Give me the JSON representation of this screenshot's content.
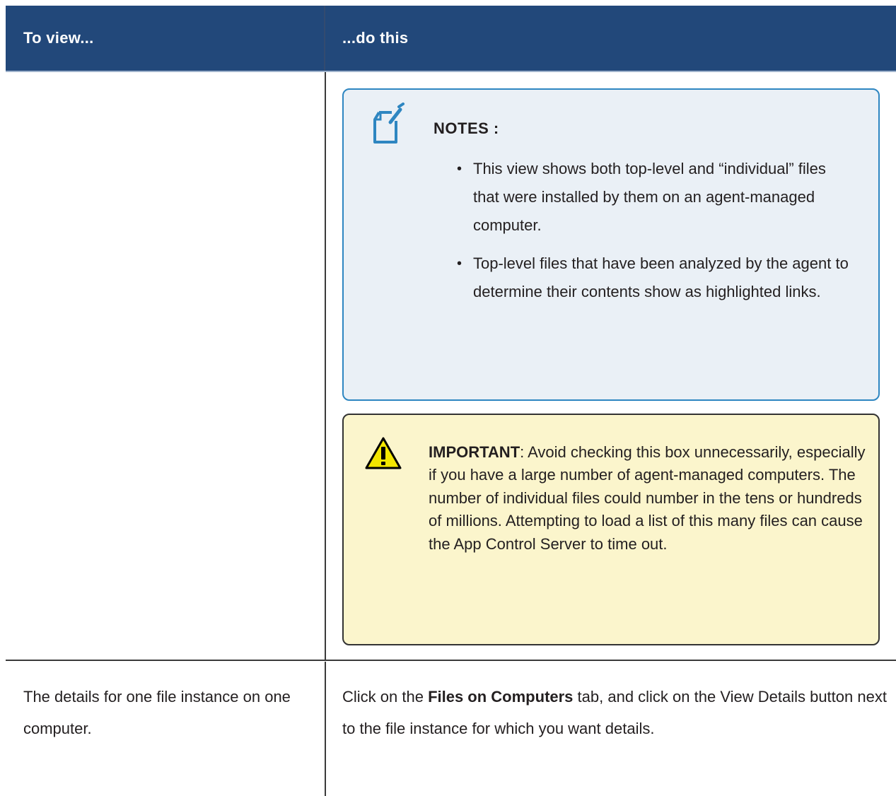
{
  "table": {
    "headers": {
      "left": "To view...",
      "right": "...do this"
    },
    "notes": {
      "title": "NOTES :",
      "items": [
        "This view shows both top-level and “individual” files that were installed by them on an agent-managed computer.",
        "Top-level files that have been analyzed by the agent to determine their contents show as highlighted links."
      ]
    },
    "important": {
      "label": "IMPORTANT",
      "text": ": Avoid checking this box unnecessarily, especially if you have a large number of agent-managed computers. The number of individual files could number in the tens or hundreds of millions. Attempting to load a list of this many files can cause the App Control Server to time out."
    },
    "row2": {
      "left": "The details for one file instance on one computer.",
      "right_before": "Click on the ",
      "right_bold": "Files on Computers",
      "right_after": " tab, and click on the View Details button next to the file instance for which you want details."
    }
  },
  "icons": {
    "notes": "note-pencil-icon",
    "important": "warning-triangle-icon"
  },
  "colors": {
    "header_bg": "#22487a",
    "notes_bg": "#eaf0f6",
    "notes_border": "#2e86c1",
    "important_bg": "#fbf5cc",
    "important_border": "#333333"
  }
}
